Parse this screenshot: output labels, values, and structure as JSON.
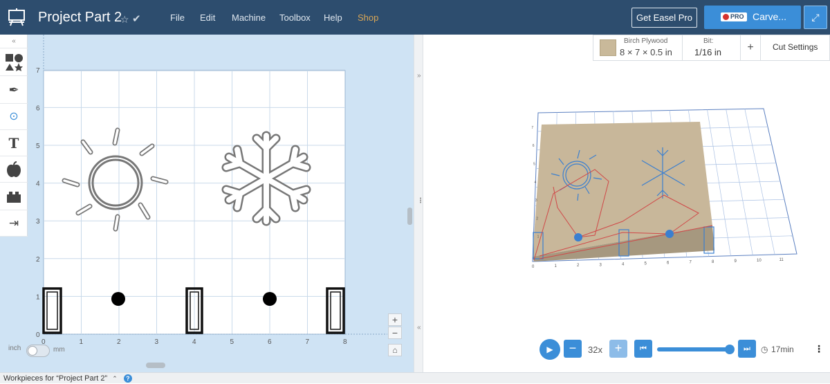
{
  "app": {
    "title": "Project Part 2",
    "colors": {
      "topbar": "#2d4d6e",
      "accent": "#3b8ed8",
      "shop": "#e0b060"
    }
  },
  "menu": [
    {
      "label": "File"
    },
    {
      "label": "Edit"
    },
    {
      "label": "Machine"
    },
    {
      "label": "Toolbox"
    },
    {
      "label": "Help"
    },
    {
      "label": "Shop"
    }
  ],
  "header_buttons": {
    "easel_pro": "Get Easel Pro",
    "pro_badge": "PRO",
    "carve": "Carve..."
  },
  "toolbar_icons": [
    "collapse-up-icon",
    "shapes-icon",
    "pen-icon",
    "target-icon",
    "text-icon",
    "apple-icon",
    "lego-brick-icon",
    "import-icon"
  ],
  "material": {
    "name": "Birch Plywood",
    "dims": "8 × 7 × 0.5 in",
    "bit_label": "Bit:",
    "bit_value": "1/16 in",
    "add": "+",
    "cut_settings": "Cut Settings"
  },
  "design_canvas": {
    "x_ticks": [
      "0",
      "1",
      "2",
      "3",
      "4",
      "5",
      "6",
      "7",
      "8"
    ],
    "y_ticks": [
      "0",
      "1",
      "2",
      "3",
      "4",
      "5",
      "6",
      "7"
    ]
  },
  "units": {
    "inch": "inch",
    "mm": "mm"
  },
  "zoom": {
    "plus": "+",
    "minus": "−"
  },
  "preview3d": {
    "x_ticks": [
      "0",
      "1",
      "2",
      "3",
      "4",
      "5",
      "6",
      "7",
      "8",
      "9",
      "10",
      "11"
    ],
    "y_ticks": [
      "1",
      "2",
      "3",
      "4",
      "5",
      "6",
      "7"
    ]
  },
  "player": {
    "speed": "32x",
    "time": "17min",
    "progress": 0.95
  },
  "bottom": {
    "workpieces": "Workpieces for “Project Part 2”"
  }
}
